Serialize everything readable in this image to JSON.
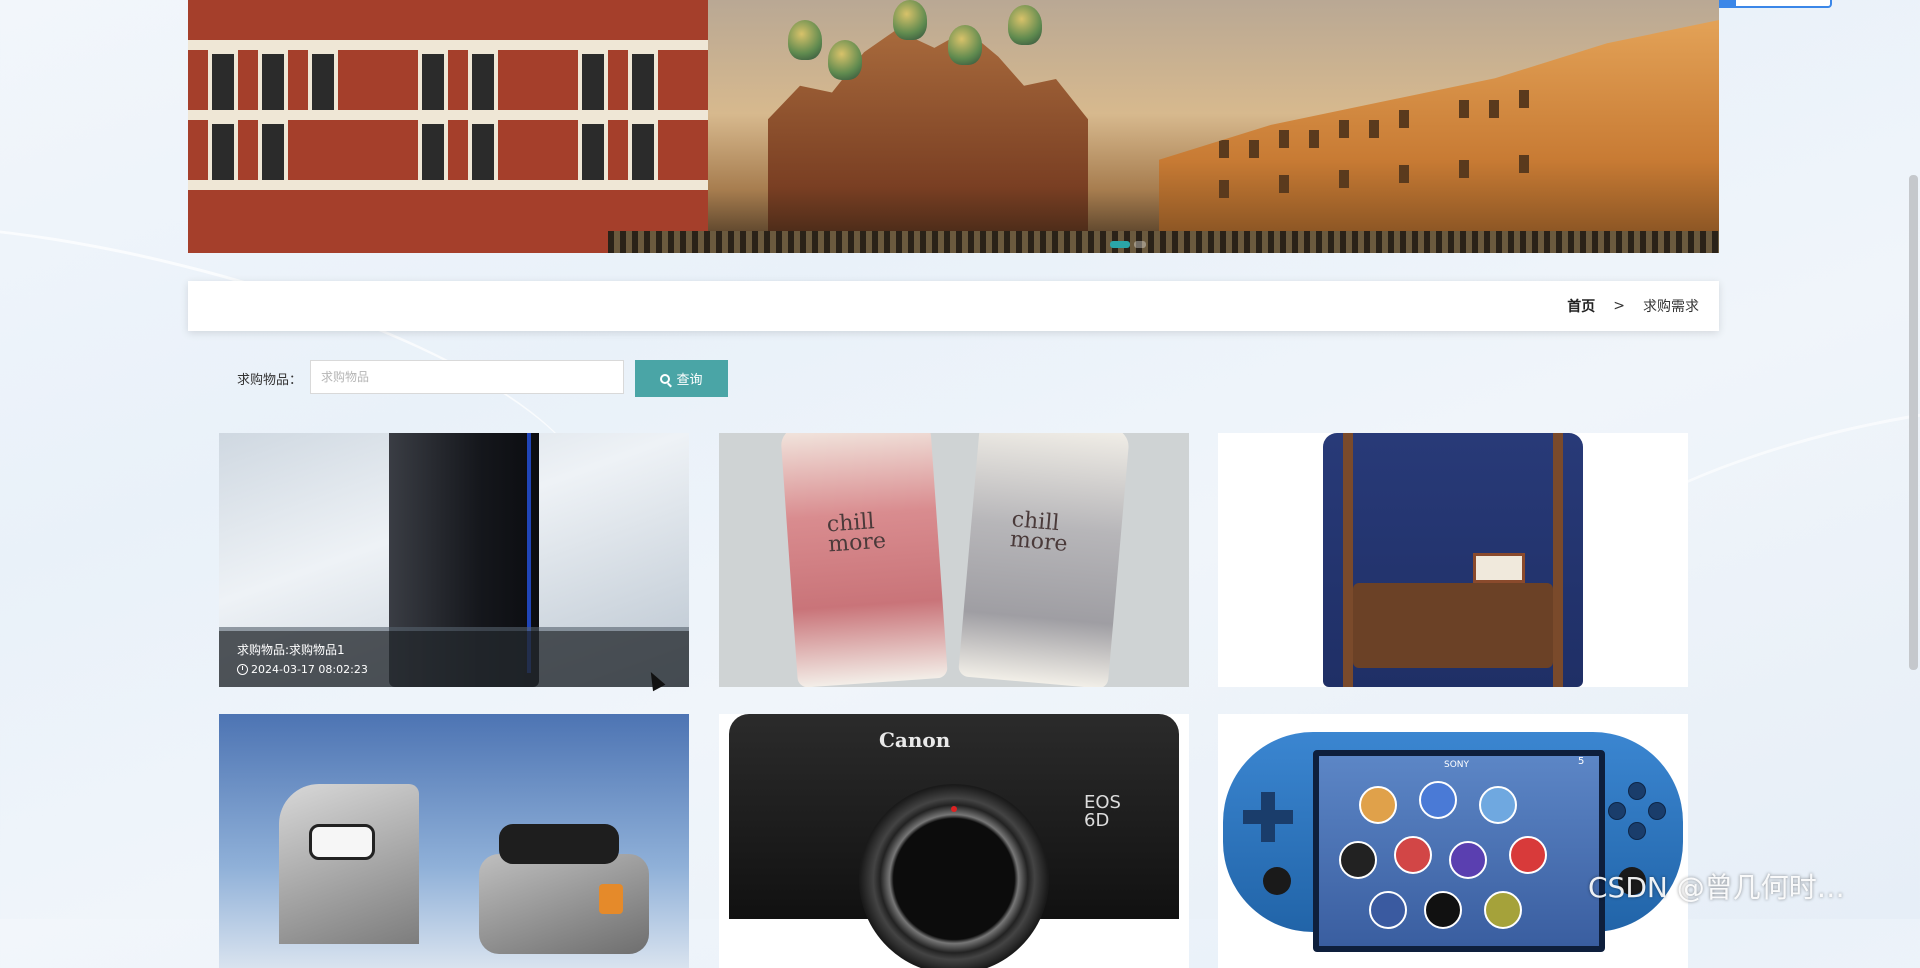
{
  "breadcrumb": {
    "home": "首页",
    "separator": ">",
    "current": "求购需求"
  },
  "search": {
    "label": "求购物品：",
    "placeholder": "求购物品",
    "button": "查询"
  },
  "cards": [
    {
      "title": "求购物品:求购物品1",
      "date": "2024-03-17 08:02:23",
      "image": "gaming-console-tower"
    },
    {
      "image": "hand-cream-tubes",
      "texts": [
        "chill",
        "more"
      ]
    },
    {
      "image": "navy-backpack"
    },
    {
      "image": "electric-scooter"
    },
    {
      "image": "canon-camera-body",
      "texts": [
        "Canon",
        "EOS",
        "6D"
      ]
    },
    {
      "image": "handheld-game-console",
      "texts": [
        "SONY",
        "5"
      ]
    }
  ],
  "watermark": "CSDN @曾几何时…",
  "colors": {
    "accent": "#4aa5a6",
    "banner_dot": "#2aa6a8",
    "top_pill": "#3b87e8"
  }
}
